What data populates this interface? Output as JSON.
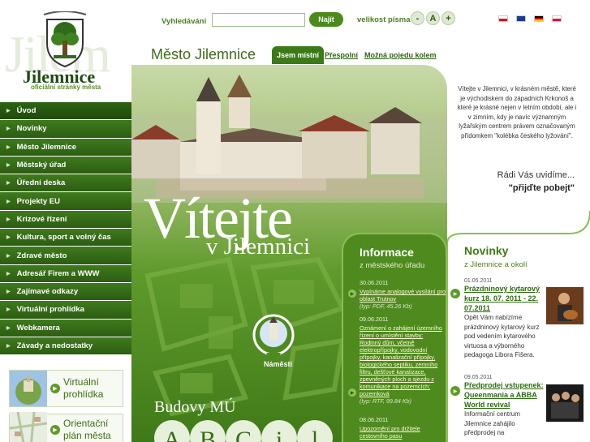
{
  "logo": {
    "title": "Jilemnice",
    "subtitle": "oficiální stránky města",
    "watermark": "Jilem"
  },
  "search": {
    "label": "Vyhledávání",
    "placeholder": "",
    "value": "",
    "button": "Najít"
  },
  "font_size": {
    "label": "velikost písma",
    "decrease": "-",
    "reset": "A",
    "increase": "+"
  },
  "languages": [
    "cz",
    "en",
    "de",
    "pl"
  ],
  "heading": "Město Jilemnice",
  "tabs": [
    {
      "label": "Jsem místní",
      "active": true
    },
    {
      "label": "Přespolní"
    },
    {
      "label": "Možná pojedu kolem"
    }
  ],
  "nav": [
    "Úvod",
    "Novinky",
    "Město Jilemnice",
    "Městský úřad",
    "Úřední deska",
    "Projekty EU",
    "Krizové řízení",
    "Kultura, sport a volný čas",
    "Zdravé město",
    "Adresář Firem a WWW",
    "Zajímavé odkazy",
    "Virtuální prohlídka",
    "Webkamera",
    "Závady a nedostatky"
  ],
  "promos": [
    {
      "line1": "Virtuální",
      "line2": "prohlídka"
    },
    {
      "line1": "Orientační",
      "line2": "plán města"
    }
  ],
  "hero": {
    "title": "Vítejte",
    "subtitle": "v Jilemnici",
    "map_pin_label": "Náměstí",
    "buildings_label": "Budovy MÚ",
    "building_letters": [
      "A",
      "B",
      "C",
      "i",
      "l"
    ]
  },
  "info": {
    "title": "Informace",
    "subtitle": "z městského úřadu",
    "items": [
      {
        "date": "30.06.2011",
        "link": "Vypínáme analogové vysílání pro oblast Trutnov",
        "meta": "(typ: PDF, 45.26 Kb)"
      },
      {
        "date": "09.06.2011",
        "link": "Oznámení o zahájení územního řízení o umístění stavby: Rodinný dům, včetně elektropřípojky, vodovodní přípojky, kanalizační přípojky, biologického septiku, zemního filtru, dešťové kanalizace, zpevněných ploch a sjezdu z komunikace na pozemcích: pozemková",
        "meta": "(typ: RTF, 99.84 Kb)"
      },
      {
        "date": "08.06.2011",
        "link": "Upozornění pro držitele cestovního pasu",
        "meta": ""
      }
    ]
  },
  "welcome": {
    "text": "Vítejte v Jilemnici, v krásném městě, které je východiskem do západních Krkonoš a které je krásné nejen v letním období, ale i v zimním, kdy je navíc významným lyžařským centrem právem označovaným přídomkem \"kolébka českého lyžování\".",
    "line2": "Rádi Vás uvidíme...",
    "line3": "\"přijďte pobejt\""
  },
  "news": {
    "title": "Novinky",
    "subtitle": "z Jilemnice a okolí",
    "items": [
      {
        "date": "01.05.2011",
        "link": "Prázdninový kytarový kurz 18. 07. 2011 - 22. 07.2011",
        "body": "Opět Vám nabízíme prázdninový kytarový kurz pod vedením kytarového virtuosa a výborného pedagoga Libora Fišera."
      },
      {
        "date": "09.05.2011",
        "link": "Předprodej vstupenek: Queenmania a ABBA World revival",
        "body": "Informační centrum Jilemnice zahájilo předprodej na"
      }
    ]
  },
  "colors": {
    "brand_green": "#3c7a18",
    "light_green": "#8bbf55",
    "nav_green": "#2c5d12"
  }
}
